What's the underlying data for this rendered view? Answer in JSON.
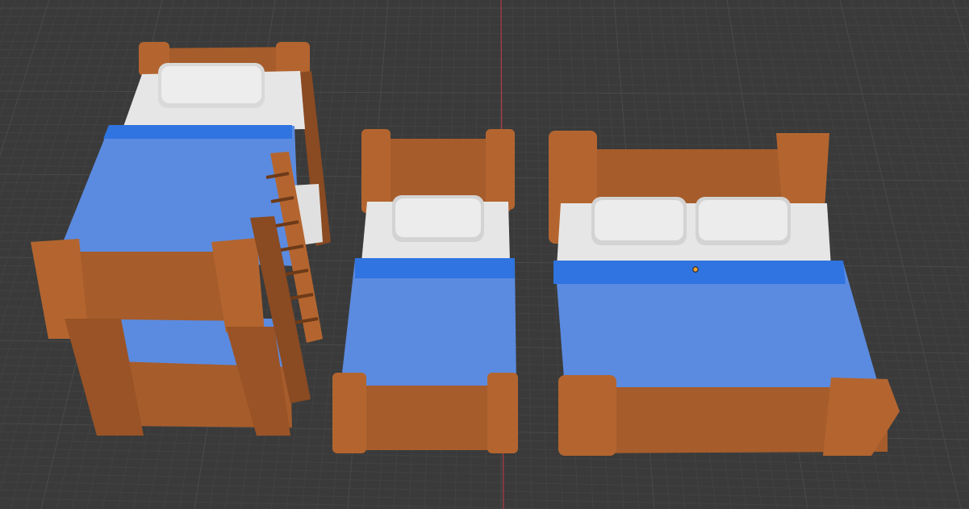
{
  "viewport": {
    "background_color": "#3a3a3a",
    "grid_minor_color": "#424242",
    "grid_major_color": "#4a4a4a",
    "y_axis_color": "#b03a48"
  },
  "colors": {
    "wood_light": "#c0703a",
    "wood_mid": "#a65c2b",
    "wood_dark": "#8a4a22",
    "sheet_white": "#e6e6e6",
    "sheet_shadow": "#c8c8c8",
    "blanket_blue": "#5b8be0",
    "blanket_edge": "#2f74e0",
    "blanket_dark": "#3f6fc6"
  },
  "objects": [
    {
      "name": "bunk-bed"
    },
    {
      "name": "single-bed"
    },
    {
      "name": "double-bed"
    }
  ],
  "origin_marker": {
    "icon": "3d-cursor-origin"
  }
}
